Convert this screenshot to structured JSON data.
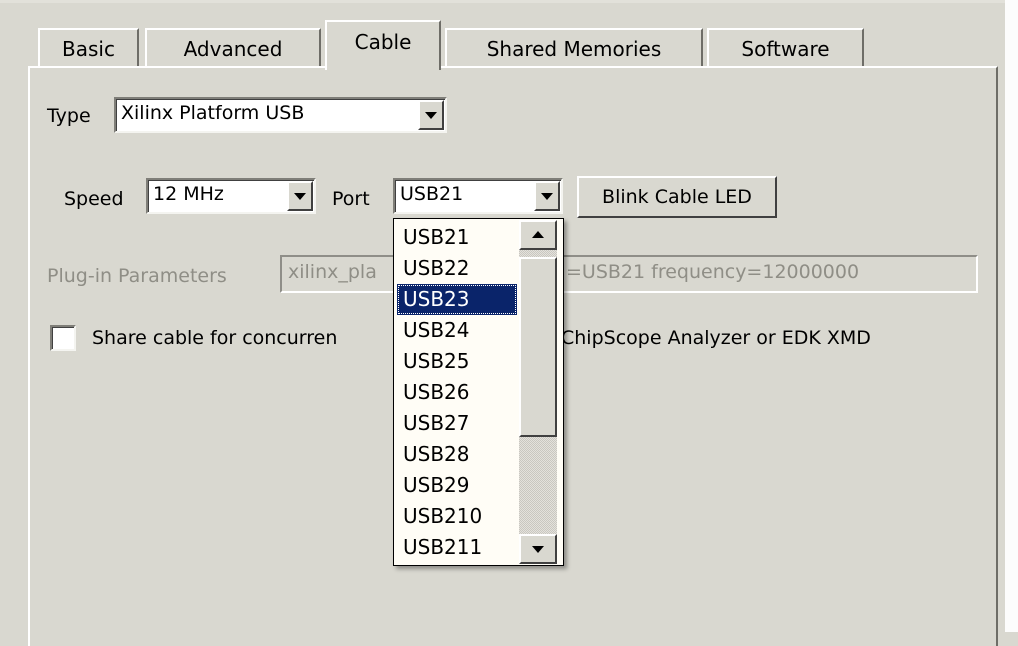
{
  "tabs": [
    {
      "label": "Basic"
    },
    {
      "label": "Advanced"
    },
    {
      "label": "Cable",
      "active": true
    },
    {
      "label": "Shared Memories"
    },
    {
      "label": "Software"
    }
  ],
  "cable": {
    "type_label": "Type",
    "type_value": "Xilinx Platform USB",
    "speed_label": "Speed",
    "speed_value": "12 MHz",
    "port_label": "Port",
    "port_value": "USB21",
    "blink_button": "Blink Cable LED",
    "plugin_label": "Plug-in Parameters",
    "plugin_value_left": "xilinx_pla",
    "plugin_value_right": "=USB21 frequency=12000000",
    "share_label_left": "Share cable for concurren",
    "share_label_right": "ChipScope Analyzer or EDK XMD",
    "share_checked": false
  },
  "port_dropdown": {
    "options": [
      "USB21",
      "USB22",
      "USB23",
      "USB24",
      "USB25",
      "USB26",
      "USB27",
      "USB28",
      "USB29",
      "USB210",
      "USB211"
    ],
    "selected": "USB23"
  },
  "icons": {
    "combo_arrow": "chevron-down-icon",
    "scroll_up": "arrow-up-icon",
    "scroll_down": "arrow-down-icon"
  },
  "colors": {
    "window_bg": "#d9d8d0",
    "selection_bg": "#0a246a",
    "list_bg": "#fffdf6"
  }
}
